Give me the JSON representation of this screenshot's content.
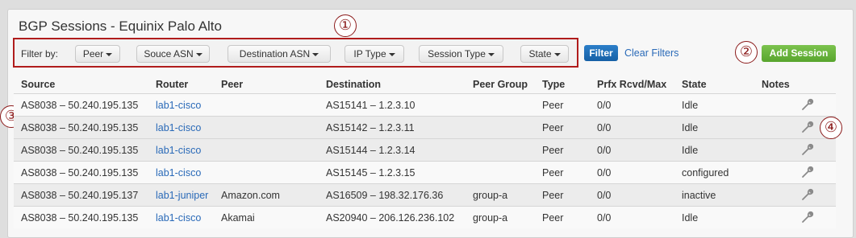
{
  "page": {
    "title": "BGP Sessions - Equinix Palo Alto"
  },
  "filters": {
    "label": "Filter by:",
    "dropdowns": [
      {
        "label": "Peer"
      },
      {
        "label": "Souce ASN"
      },
      {
        "label": "Destination ASN"
      },
      {
        "label": "IP Type"
      },
      {
        "label": "Session Type"
      },
      {
        "label": "State"
      }
    ],
    "filter_button": "Filter",
    "clear_link": "Clear Filters"
  },
  "actions": {
    "add_session": "Add Session"
  },
  "callouts": [
    "①",
    "②",
    "③",
    "④"
  ],
  "table": {
    "columns": [
      "Source",
      "Router",
      "Peer",
      "Destination",
      "Peer Group",
      "Type",
      "Prfx Rcvd/Max",
      "State",
      "Notes"
    ],
    "rows": [
      {
        "source": "AS8038 – 50.240.195.135",
        "router": "lab1-cisco",
        "peer": "",
        "destination": "AS15141 – 1.2.3.10",
        "peer_group": "",
        "type": "Peer",
        "prfx": "0/0",
        "state": "Idle"
      },
      {
        "source": "AS8038 – 50.240.195.135",
        "router": "lab1-cisco",
        "peer": "",
        "destination": "AS15142 – 1.2.3.11",
        "peer_group": "",
        "type": "Peer",
        "prfx": "0/0",
        "state": "Idle"
      },
      {
        "source": "AS8038 – 50.240.195.135",
        "router": "lab1-cisco",
        "peer": "",
        "destination": "AS15144 – 1.2.3.14",
        "peer_group": "",
        "type": "Peer",
        "prfx": "0/0",
        "state": "Idle"
      },
      {
        "source": "AS8038 – 50.240.195.135",
        "router": "lab1-cisco",
        "peer": "",
        "destination": "AS15145 – 1.2.3.15",
        "peer_group": "",
        "type": "Peer",
        "prfx": "0/0",
        "state": "configured"
      },
      {
        "source": "AS8038 – 50.240.195.137",
        "router": "lab1-juniper",
        "peer": "Amazon.com",
        "destination": "AS16509 – 198.32.176.36",
        "peer_group": "group-a",
        "type": "Peer",
        "prfx": "0/0",
        "state": "inactive"
      },
      {
        "source": "AS8038 – 50.240.195.135",
        "router": "lab1-cisco",
        "peer": "Akamai",
        "destination": "AS20940 – 206.126.236.102",
        "peer_group": "group-a",
        "type": "Peer",
        "prfx": "0/0",
        "state": "Idle"
      }
    ]
  },
  "colors": {
    "accent_blue": "#1660a6",
    "add_green": "#58a52e",
    "callout_red": "#8b1a1a",
    "link": "#2a6ab8"
  }
}
